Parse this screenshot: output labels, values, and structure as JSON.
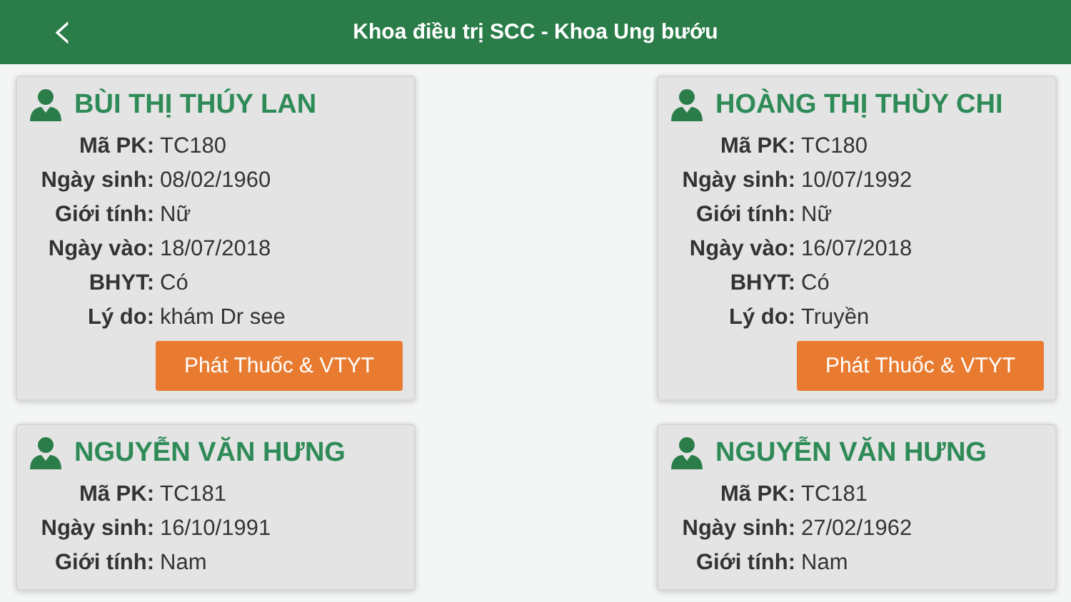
{
  "header": {
    "back_icon": "‹",
    "title": "Khoa điều trị SCC - Khoa Ung bướu"
  },
  "patients": [
    {
      "name": "BÙI THỊ THÚY LAN",
      "fields": [
        {
          "label": "Mã PK:",
          "value": "TC180"
        },
        {
          "label": "Ngày sinh:",
          "value": "08/02/1960"
        },
        {
          "label": "Giới tính:",
          "value": "Nữ"
        },
        {
          "label": "Ngày vào:",
          "value": "18/07/2018"
        },
        {
          "label": "BHYT:",
          "value": "Có"
        },
        {
          "label": "Lý do:",
          "value": "khám Dr see"
        }
      ],
      "button": "Phát Thuốc & VTYT"
    },
    {
      "name": "HOÀNG THỊ THÙY CHI",
      "fields": [
        {
          "label": "Mã PK:",
          "value": "TC180"
        },
        {
          "label": "Ngày sinh:",
          "value": "10/07/1992"
        },
        {
          "label": "Giới tính:",
          "value": "Nữ"
        },
        {
          "label": "Ngày vào:",
          "value": "16/07/2018"
        },
        {
          "label": "BHYT:",
          "value": "Có"
        },
        {
          "label": "Lý do:",
          "value": "Truyền"
        }
      ],
      "button": "Phát Thuốc & VTYT"
    },
    {
      "name": "NGUYỄN VĂN HƯNG",
      "fields": [
        {
          "label": "Mã PK:",
          "value": "TC181"
        },
        {
          "label": "Ngày sinh:",
          "value": "16/10/1991"
        },
        {
          "label": "Giới tính:",
          "value": "Nam"
        }
      ]
    },
    {
      "name": "NGUYỄN VĂN HƯNG",
      "fields": [
        {
          "label": "Mã PK:",
          "value": "TC181"
        },
        {
          "label": "Ngày sinh:",
          "value": "27/02/1962"
        },
        {
          "label": "Giới tính:",
          "value": "Nam"
        }
      ]
    }
  ]
}
